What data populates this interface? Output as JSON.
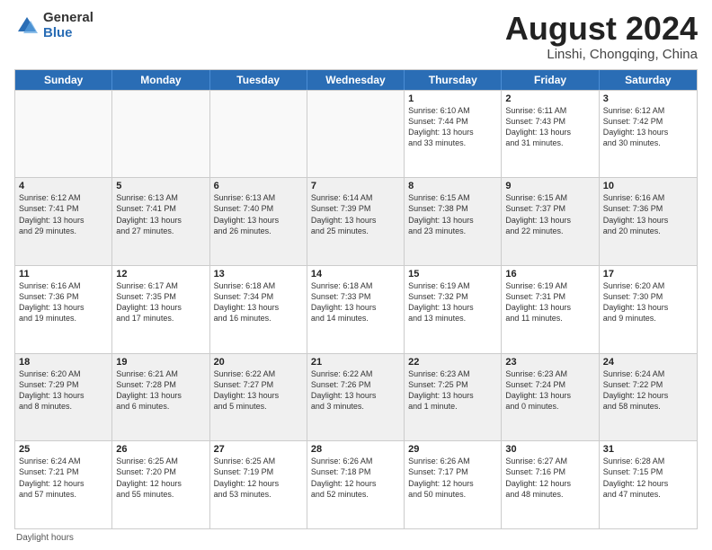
{
  "logo": {
    "general": "General",
    "blue": "Blue"
  },
  "title": {
    "month_year": "August 2024",
    "location": "Linshi, Chongqing, China"
  },
  "days_of_week": [
    "Sunday",
    "Monday",
    "Tuesday",
    "Wednesday",
    "Thursday",
    "Friday",
    "Saturday"
  ],
  "footer_label": "Daylight hours",
  "weeks": [
    [
      {
        "day": "",
        "info": "",
        "empty": true
      },
      {
        "day": "",
        "info": "",
        "empty": true
      },
      {
        "day": "",
        "info": "",
        "empty": true
      },
      {
        "day": "",
        "info": "",
        "empty": true
      },
      {
        "day": "1",
        "info": "Sunrise: 6:10 AM\nSunset: 7:44 PM\nDaylight: 13 hours\nand 33 minutes.",
        "empty": false
      },
      {
        "day": "2",
        "info": "Sunrise: 6:11 AM\nSunset: 7:43 PM\nDaylight: 13 hours\nand 31 minutes.",
        "empty": false
      },
      {
        "day": "3",
        "info": "Sunrise: 6:12 AM\nSunset: 7:42 PM\nDaylight: 13 hours\nand 30 minutes.",
        "empty": false
      }
    ],
    [
      {
        "day": "4",
        "info": "Sunrise: 6:12 AM\nSunset: 7:41 PM\nDaylight: 13 hours\nand 29 minutes.",
        "empty": false,
        "shaded": true
      },
      {
        "day": "5",
        "info": "Sunrise: 6:13 AM\nSunset: 7:41 PM\nDaylight: 13 hours\nand 27 minutes.",
        "empty": false,
        "shaded": true
      },
      {
        "day": "6",
        "info": "Sunrise: 6:13 AM\nSunset: 7:40 PM\nDaylight: 13 hours\nand 26 minutes.",
        "empty": false,
        "shaded": true
      },
      {
        "day": "7",
        "info": "Sunrise: 6:14 AM\nSunset: 7:39 PM\nDaylight: 13 hours\nand 25 minutes.",
        "empty": false,
        "shaded": true
      },
      {
        "day": "8",
        "info": "Sunrise: 6:15 AM\nSunset: 7:38 PM\nDaylight: 13 hours\nand 23 minutes.",
        "empty": false,
        "shaded": true
      },
      {
        "day": "9",
        "info": "Sunrise: 6:15 AM\nSunset: 7:37 PM\nDaylight: 13 hours\nand 22 minutes.",
        "empty": false,
        "shaded": true
      },
      {
        "day": "10",
        "info": "Sunrise: 6:16 AM\nSunset: 7:36 PM\nDaylight: 13 hours\nand 20 minutes.",
        "empty": false,
        "shaded": true
      }
    ],
    [
      {
        "day": "11",
        "info": "Sunrise: 6:16 AM\nSunset: 7:36 PM\nDaylight: 13 hours\nand 19 minutes.",
        "empty": false
      },
      {
        "day": "12",
        "info": "Sunrise: 6:17 AM\nSunset: 7:35 PM\nDaylight: 13 hours\nand 17 minutes.",
        "empty": false
      },
      {
        "day": "13",
        "info": "Sunrise: 6:18 AM\nSunset: 7:34 PM\nDaylight: 13 hours\nand 16 minutes.",
        "empty": false
      },
      {
        "day": "14",
        "info": "Sunrise: 6:18 AM\nSunset: 7:33 PM\nDaylight: 13 hours\nand 14 minutes.",
        "empty": false
      },
      {
        "day": "15",
        "info": "Sunrise: 6:19 AM\nSunset: 7:32 PM\nDaylight: 13 hours\nand 13 minutes.",
        "empty": false
      },
      {
        "day": "16",
        "info": "Sunrise: 6:19 AM\nSunset: 7:31 PM\nDaylight: 13 hours\nand 11 minutes.",
        "empty": false
      },
      {
        "day": "17",
        "info": "Sunrise: 6:20 AM\nSunset: 7:30 PM\nDaylight: 13 hours\nand 9 minutes.",
        "empty": false
      }
    ],
    [
      {
        "day": "18",
        "info": "Sunrise: 6:20 AM\nSunset: 7:29 PM\nDaylight: 13 hours\nand 8 minutes.",
        "empty": false,
        "shaded": true
      },
      {
        "day": "19",
        "info": "Sunrise: 6:21 AM\nSunset: 7:28 PM\nDaylight: 13 hours\nand 6 minutes.",
        "empty": false,
        "shaded": true
      },
      {
        "day": "20",
        "info": "Sunrise: 6:22 AM\nSunset: 7:27 PM\nDaylight: 13 hours\nand 5 minutes.",
        "empty": false,
        "shaded": true
      },
      {
        "day": "21",
        "info": "Sunrise: 6:22 AM\nSunset: 7:26 PM\nDaylight: 13 hours\nand 3 minutes.",
        "empty": false,
        "shaded": true
      },
      {
        "day": "22",
        "info": "Sunrise: 6:23 AM\nSunset: 7:25 PM\nDaylight: 13 hours\nand 1 minute.",
        "empty": false,
        "shaded": true
      },
      {
        "day": "23",
        "info": "Sunrise: 6:23 AM\nSunset: 7:24 PM\nDaylight: 13 hours\nand 0 minutes.",
        "empty": false,
        "shaded": true
      },
      {
        "day": "24",
        "info": "Sunrise: 6:24 AM\nSunset: 7:22 PM\nDaylight: 12 hours\nand 58 minutes.",
        "empty": false,
        "shaded": true
      }
    ],
    [
      {
        "day": "25",
        "info": "Sunrise: 6:24 AM\nSunset: 7:21 PM\nDaylight: 12 hours\nand 57 minutes.",
        "empty": false
      },
      {
        "day": "26",
        "info": "Sunrise: 6:25 AM\nSunset: 7:20 PM\nDaylight: 12 hours\nand 55 minutes.",
        "empty": false
      },
      {
        "day": "27",
        "info": "Sunrise: 6:25 AM\nSunset: 7:19 PM\nDaylight: 12 hours\nand 53 minutes.",
        "empty": false
      },
      {
        "day": "28",
        "info": "Sunrise: 6:26 AM\nSunset: 7:18 PM\nDaylight: 12 hours\nand 52 minutes.",
        "empty": false
      },
      {
        "day": "29",
        "info": "Sunrise: 6:26 AM\nSunset: 7:17 PM\nDaylight: 12 hours\nand 50 minutes.",
        "empty": false
      },
      {
        "day": "30",
        "info": "Sunrise: 6:27 AM\nSunset: 7:16 PM\nDaylight: 12 hours\nand 48 minutes.",
        "empty": false
      },
      {
        "day": "31",
        "info": "Sunrise: 6:28 AM\nSunset: 7:15 PM\nDaylight: 12 hours\nand 47 minutes.",
        "empty": false
      }
    ]
  ]
}
